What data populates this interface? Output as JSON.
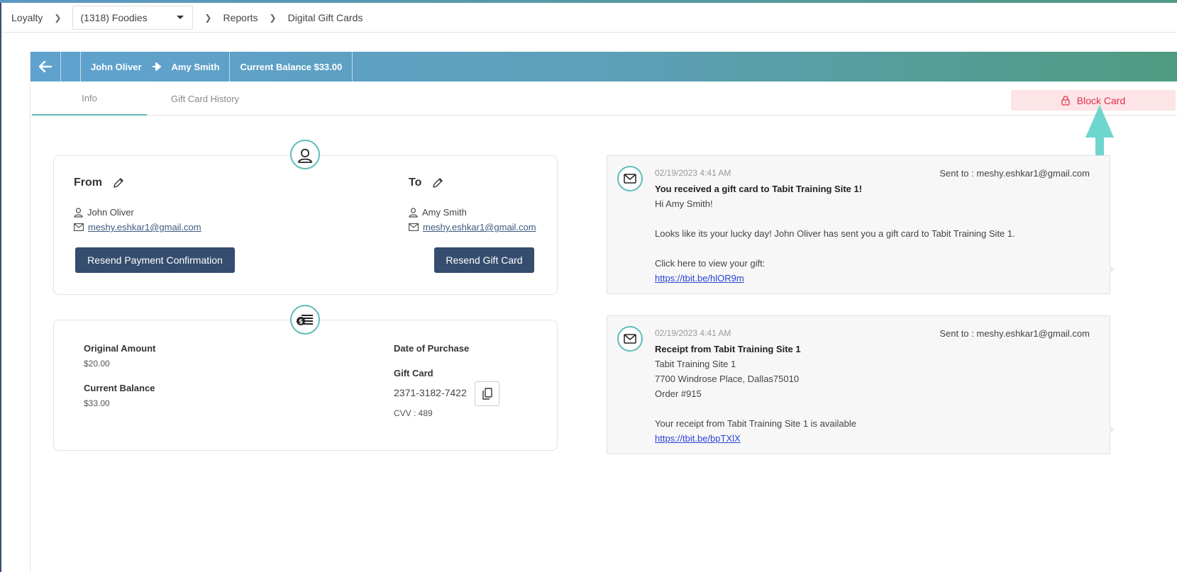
{
  "breadcrumb": {
    "root": "Loyalty",
    "site": "(1318) Foodies",
    "reports": "Reports",
    "current": "Digital Gift Cards"
  },
  "header": {
    "from_name": "John Oliver",
    "to_name": "Amy Smith",
    "balance": "Current Balance $33.00"
  },
  "tabs": {
    "info": "Info",
    "history": "Gift Card History"
  },
  "block_button": "Block Card",
  "parties": {
    "from": {
      "title": "From",
      "name": "John Oliver",
      "email": "meshy.eshkar1@gmail.com",
      "button": "Resend Payment Confirmation"
    },
    "to": {
      "title": "To",
      "name": "Amy Smith",
      "email": "meshy.eshkar1@gmail.com",
      "button": "Resend Gift Card"
    }
  },
  "amounts": {
    "original_label": "Original Amount",
    "original_value": "$20.00",
    "current_label": "Current Balance",
    "current_value": "$33.00",
    "date_label": "Date of Purchase",
    "giftcard_label": "Gift Card",
    "giftcard_number": "2371-3182-7422",
    "cvv": "CVV : 489"
  },
  "messages": [
    {
      "date": "02/19/2023 4:41 AM",
      "sent_to": "Sent to : meshy.eshkar1@gmail.com",
      "subject": "You received a gift card to Tabit Training Site 1!",
      "line1": "Hi Amy Smith!",
      "line2": "Looks like its your lucky day! John Oliver has sent you a gift card to Tabit Training Site 1.",
      "line3": "Click here to view your gift:",
      "link": "https://tbit.be/hlOR9m"
    },
    {
      "date": "02/19/2023 4:41 AM",
      "sent_to": "Sent to : meshy.eshkar1@gmail.com",
      "subject": "Receipt from Tabit Training Site 1",
      "line1": "Tabit Training Site 1",
      "line2": "7700 Windrose Place, Dallas75010",
      "line3": "Order #915",
      "line4": "Your receipt from Tabit Training Site 1 is available",
      "link": "https://tbit.be/bpTXlX"
    }
  ],
  "colors": {
    "accent_teal": "#5fbcb8",
    "button_dark": "#354d6e",
    "block_red": "#e0304a",
    "annotation_arrow": "#6fd6cf"
  }
}
